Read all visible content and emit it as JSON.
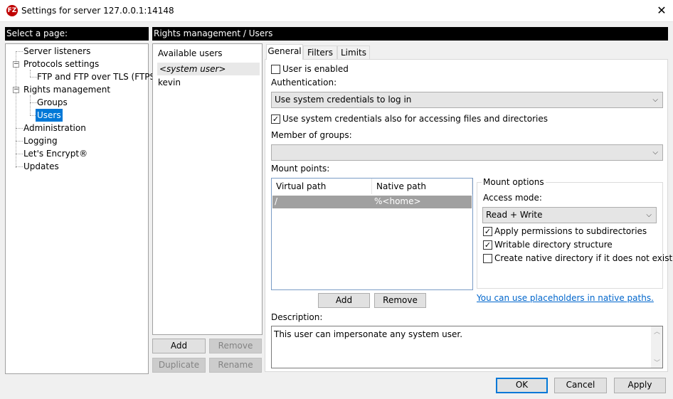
{
  "window": {
    "title": "Settings for server 127.0.0.1:14148",
    "app_icon_glyph": "FZ"
  },
  "page_tree": {
    "header": "Select a page:",
    "items": [
      {
        "label": "Server listeners",
        "level": 0
      },
      {
        "label": "Protocols settings",
        "level": 0
      },
      {
        "label": "FTP and FTP over TLS (FTPS)",
        "level": 1
      },
      {
        "label": "Rights management",
        "level": 0
      },
      {
        "label": "Groups",
        "level": 1
      },
      {
        "label": "Users",
        "level": 1,
        "selected": true
      },
      {
        "label": "Administration",
        "level": 0
      },
      {
        "label": "Logging",
        "level": 0
      },
      {
        "label": "Let's Encrypt®",
        "level": 0
      },
      {
        "label": "Updates",
        "level": 0
      }
    ],
    "expander_glyph": "−"
  },
  "content_header": "Rights management / Users",
  "users": {
    "title": "Available users",
    "items": [
      "<system user>",
      "kevin"
    ],
    "selected_index": 0,
    "buttons": {
      "add": "Add",
      "remove": "Remove",
      "duplicate": "Duplicate",
      "rename": "Rename"
    }
  },
  "tabs": [
    {
      "label": "General",
      "active": true
    },
    {
      "label": "Filters"
    },
    {
      "label": "Limits"
    }
  ],
  "general": {
    "user_enabled": {
      "label": "User is enabled",
      "checked": false
    },
    "authentication": {
      "label": "Authentication:",
      "value": "Use system credentials to log in"
    },
    "use_system_creds": {
      "label": "Use system credentials also for accessing files and directories",
      "checked": true
    },
    "member_of_groups": {
      "label": "Member of groups:",
      "value": ""
    },
    "mount_points": {
      "label": "Mount points:",
      "columns": [
        "Virtual path",
        "Native path"
      ],
      "rows": [
        [
          "/",
          "%<home>"
        ]
      ],
      "add_label": "Add",
      "remove_label": "Remove"
    },
    "mount_options": {
      "title": "Mount options",
      "access_mode_label": "Access mode:",
      "access_mode_value": "Read + Write",
      "apply_perms": {
        "label": "Apply permissions to subdirectories",
        "checked": true
      },
      "writable_dir": {
        "label": "Writable directory structure",
        "checked": true
      },
      "create_native": {
        "label": "Create native directory if it does not exist",
        "checked": false
      }
    },
    "placeholder_link": "You can use placeholders in native paths.",
    "description": {
      "label": "Description:",
      "value": "This user can impersonate any system user."
    }
  },
  "footer": {
    "ok": "OK",
    "cancel": "Cancel",
    "apply": "Apply"
  },
  "glyphs": {
    "close": "✕",
    "check": "✓",
    "dropdown": "⌵",
    "scroll_up": "︿",
    "scroll_down": "﹀"
  },
  "colors": {
    "selection": "#0078d7",
    "header_bg": "#000000",
    "link": "#0066cc"
  }
}
